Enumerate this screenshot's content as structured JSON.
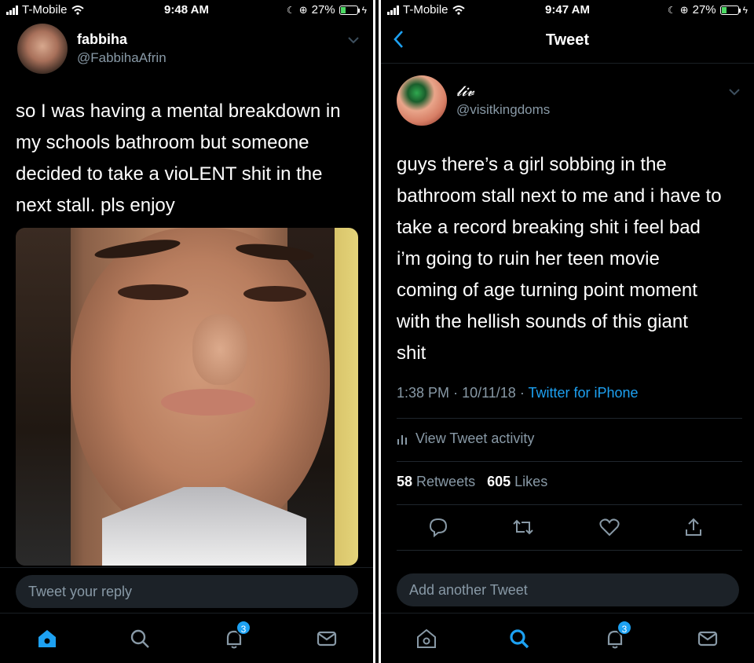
{
  "left": {
    "status": {
      "carrier": "T-Mobile",
      "time": "9:48 AM",
      "battery": "27%"
    },
    "author": {
      "name": "fabbiha",
      "handle": "@FabbihaAfrin"
    },
    "tweet_lines": [
      "so I was having a mental breakdown in",
      "my schools bathroom but someone",
      "decided to take a vioLENT shit in the",
      "next stall. pls enjoy"
    ],
    "reply_placeholder": "Tweet your reply",
    "notification_badge": "3"
  },
  "right": {
    "status": {
      "carrier": "T-Mobile",
      "time": "9:47 AM",
      "battery": "27%"
    },
    "nav_title": "Tweet",
    "author": {
      "name": "𝓵𝓲𝓿",
      "handle": "@visitkingdoms"
    },
    "tweet_lines": [
      "guys there’s a girl sobbing in the",
      "bathroom stall next to me and i have to",
      "take a record breaking shit i feel bad",
      "i’m going to ruin her teen movie",
      "coming of age turning point moment",
      "with the hellish sounds of this giant",
      "shit"
    ],
    "meta": {
      "time": "1:38 PM",
      "date": "10/11/18",
      "via": "Twitter for iPhone"
    },
    "activity_label": "View Tweet activity",
    "stats": {
      "retweets": "58",
      "retweets_label": "Retweets",
      "likes": "605",
      "likes_label": "Likes"
    },
    "reply_placeholder": "Add another Tweet",
    "notification_badge": "3"
  },
  "colors": {
    "accent": "#1da1f2",
    "muted": "#8899a6",
    "background": "#000000",
    "input_bg": "#1c2228",
    "battery": "#4cd964"
  }
}
